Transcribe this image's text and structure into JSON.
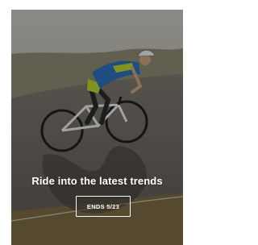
{
  "promo": {
    "headline": "Ride into the latest trends",
    "button_label": "ENDS 5/23"
  },
  "colors": {
    "overlay": "#000000",
    "text": "#ffffff",
    "jersey": "#2f6fb8",
    "accent": "#b7d433",
    "road": "#67625b",
    "hillside": "#7c7a60"
  }
}
